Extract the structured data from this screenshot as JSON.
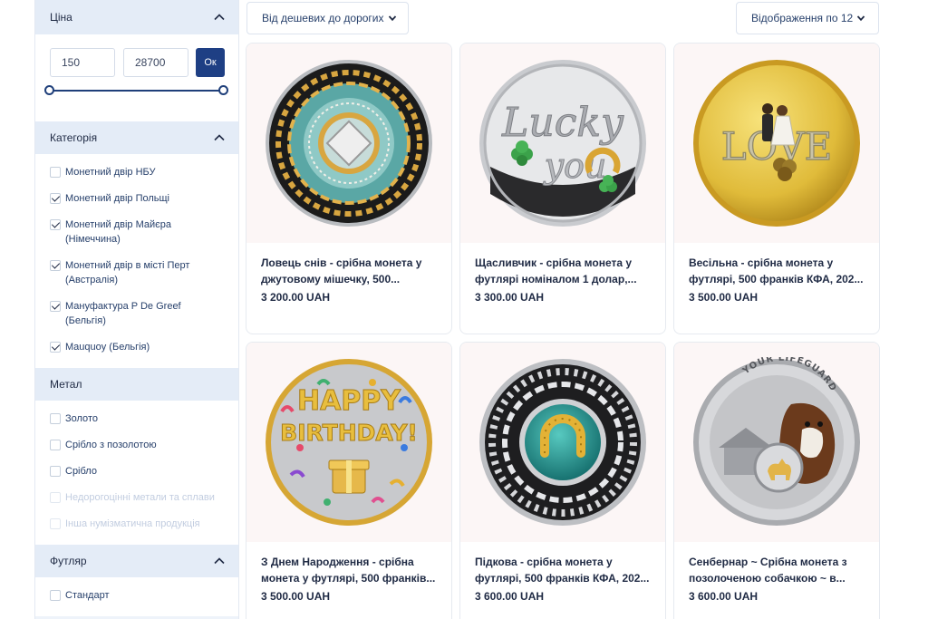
{
  "sidebar": {
    "price": {
      "title": "Ціна",
      "min": "150",
      "max": "28700",
      "ok_label": "Ок"
    },
    "category": {
      "title": "Категорія",
      "items": [
        {
          "label": "Монетний двір НБУ",
          "checked": false
        },
        {
          "label": "Монетний двір Польщі",
          "checked": true
        },
        {
          "label": "Монетний двір Майєра (Німеччина)",
          "checked": true
        },
        {
          "label": "Монетний двір в місті Перт (Австралія)",
          "checked": true
        },
        {
          "label": "Мануфактура P De Greef (Бельгія)",
          "checked": true
        },
        {
          "label": "Mauquoy (Бельгія)",
          "checked": true
        }
      ]
    },
    "metal": {
      "title": "Метал",
      "items": [
        {
          "label": "Золото",
          "checked": false,
          "disabled": false
        },
        {
          "label": "Срібло з позолотою",
          "checked": false,
          "disabled": false
        },
        {
          "label": "Срібло",
          "checked": false,
          "disabled": false
        },
        {
          "label": "Недорогоцінні метали та сплави",
          "checked": false,
          "disabled": true
        },
        {
          "label": "Інша нумізматична продукція",
          "checked": false,
          "disabled": true
        }
      ]
    },
    "case": {
      "title": "Футляр",
      "items": [
        {
          "label": "Стандарт",
          "checked": false
        }
      ]
    }
  },
  "toolbar": {
    "sort_label": "Від дешевих до дорогих",
    "per_page_label": "Відображення по 12"
  },
  "products": [
    {
      "title": "Ловець снів - срібна монета у джутовому мішечку, 500...",
      "price": "3 200.00 UAH",
      "image": "dreamcatcher-coin"
    },
    {
      "title": "Щасливчик - срібна монета у футлярі номіналом 1 долар,...",
      "price": "3 300.00 UAH",
      "image": "lucky-you-coin"
    },
    {
      "title": "Весільна - срібна монета у футлярі, 500 франків КФА, 202...",
      "price": "3 500.00 UAH",
      "image": "love-coin"
    },
    {
      "title": "З Днем Народження - срібна монета у футлярі, 500 франків...",
      "price": "3 500.00 UAH",
      "image": "birthday-coin"
    },
    {
      "title": "Підкова - срібна монета у футлярі, 500 франків КФА, 202...",
      "price": "3 600.00 UAH",
      "image": "horseshoe-coin"
    },
    {
      "title": "Сенбернар ~ Срібна монета з позолоченою собачкою ~ в...",
      "price": "3 600.00 UAH",
      "image": "saint-bernard-coin"
    }
  ],
  "coin_texts": {
    "lucky": "Lucky",
    "you": "you",
    "love": "LOVE",
    "happy": "HAPPY",
    "birthday": "BIRTHDAY!",
    "lifeguard": "YOUR LIFEGUARD"
  },
  "colors": {
    "accent": "#1e3f84",
    "text": "#1f2a44",
    "sidebar_bg": "#eef3fa",
    "card_image_bg": "#fcf6f6"
  }
}
